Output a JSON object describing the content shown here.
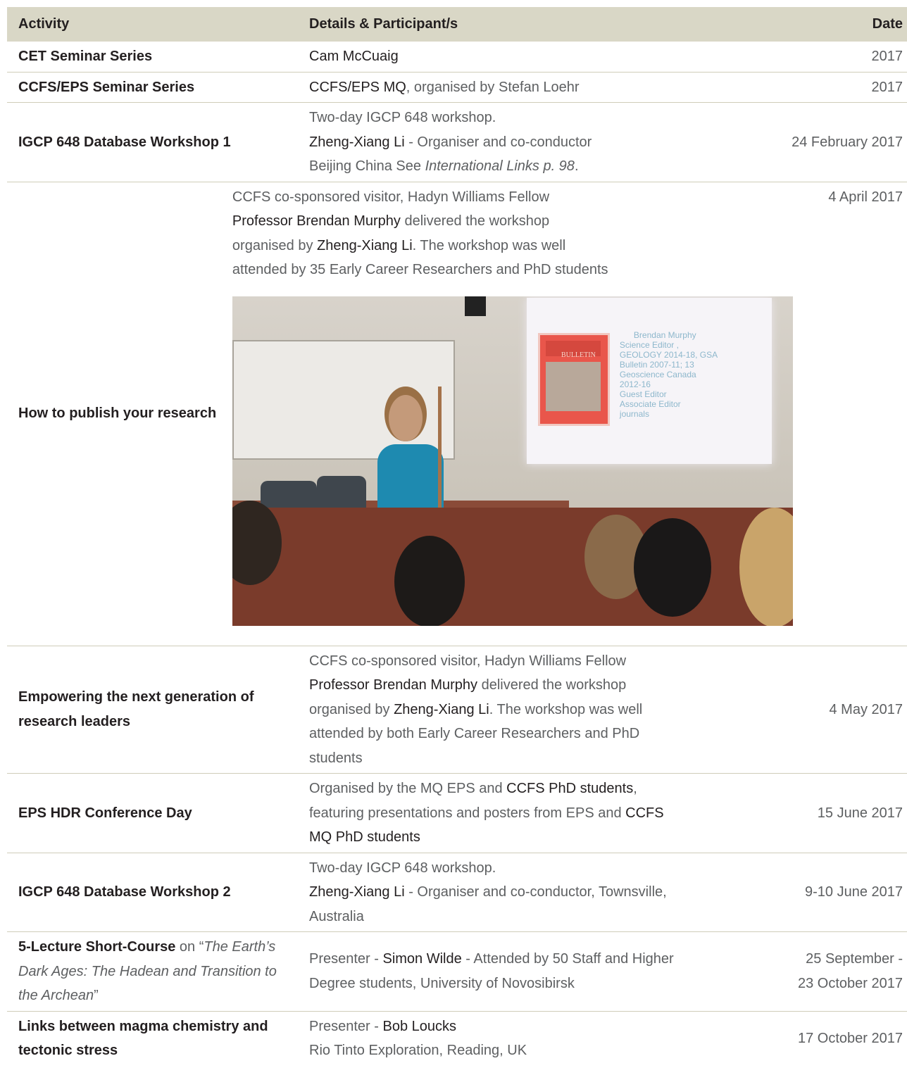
{
  "header": {
    "activity": "Activity",
    "details": "Details & Participant/s",
    "date": "Date"
  },
  "rows": [
    {
      "activity": "CET Seminar Series",
      "details_name": "Cam McCuaig",
      "date": "2017"
    },
    {
      "activity": "CCFS/EPS Seminar Series",
      "details_name": "CCFS/EPS MQ",
      "details_rest": ", organised by Stefan Loehr",
      "date": "2017"
    },
    {
      "activity": "IGCP 648 Database Workshop 1",
      "line1": "Two-day IGCP 648 workshop.",
      "name": "Zheng-Xiang Li",
      "line2_rest": " - Organiser and co-conductor",
      "line3": "Beijing China  See ",
      "line3_it": "International Links p. 98",
      "line3_end": ".",
      "date": "24 February 2017"
    },
    {
      "activity": "How to publish your research",
      "p1": "CCFS co-sponsored visitor, Hadyn Williams Fellow",
      "name1": "Professor Brendan Murphy",
      "p2": " delivered the workshop",
      "p3": "organised by ",
      "name2": "Zheng-Xiang Li",
      "p4": ".  The workshop was well",
      "p5": "attended by 35 Early Career Researchers and PhD students",
      "date": "4 April 2017"
    },
    {
      "activity": "Empowering the next generation of research leaders",
      "p1": "CCFS co-sponsored visitor, Hadyn Williams Fellow",
      "name1": "Professor Brendan Murphy",
      "p2": " delivered the workshop",
      "p3": "organised by ",
      "name2": "Zheng-Xiang Li",
      "p4": ".  The workshop was well",
      "p5": "attended by both Early Career Researchers and PhD",
      "p6": "students",
      "date": "4 May 2017"
    },
    {
      "activity": "EPS HDR Conference Day",
      "p1": "Organised by the MQ EPS and ",
      "name1": "CCFS PhD students",
      "p2": ",",
      "p3": "featuring presentations and posters from EPS and ",
      "name2": "CCFS",
      "name3": "MQ PhD students",
      "date": "15 June 2017"
    },
    {
      "activity": "IGCP 648 Database Workshop 2",
      "line1": "Two-day IGCP 648 workshop.",
      "name": "Zheng-Xiang Li",
      "line2_rest": " - Organiser and co-conductor, Townsville,",
      "line3": "Australia",
      "date": "9-10 June 2017"
    },
    {
      "activity_bold": "5-Lecture Short-Course",
      "activity_on": " on “",
      "activity_it1": "The Earth’s",
      "activity_it2": "Dark Ages: The Hadean and Transition to",
      "activity_it3": "the Archean",
      "activity_end": "”",
      "p1": "Presenter - ",
      "name": "Simon Wilde",
      "p2": " - Attended by 50 Staff and Higher",
      "p3": "Degree students, University of Novosibirsk",
      "date1": "25 September -",
      "date2": "23 October 2017"
    },
    {
      "activity": "Links between magma chemistry and tectonic stress",
      "p1": "Presenter - ",
      "name": "Bob Loucks",
      "p2": "Rio Tinto Exploration, Reading, UK",
      "date": "17 October 2017"
    }
  ],
  "photo": {
    "screen_lines": [
      "Brendan Murphy",
      "Science Editor ,",
      "GEOLOGY 2014-18, GSA",
      "Bulletin 2007-11; 13",
      "Geoscience Canada",
      "2012-16",
      "Guest Editor",
      "Associate Editor",
      "journals"
    ],
    "cover_title": "BULLETIN"
  }
}
